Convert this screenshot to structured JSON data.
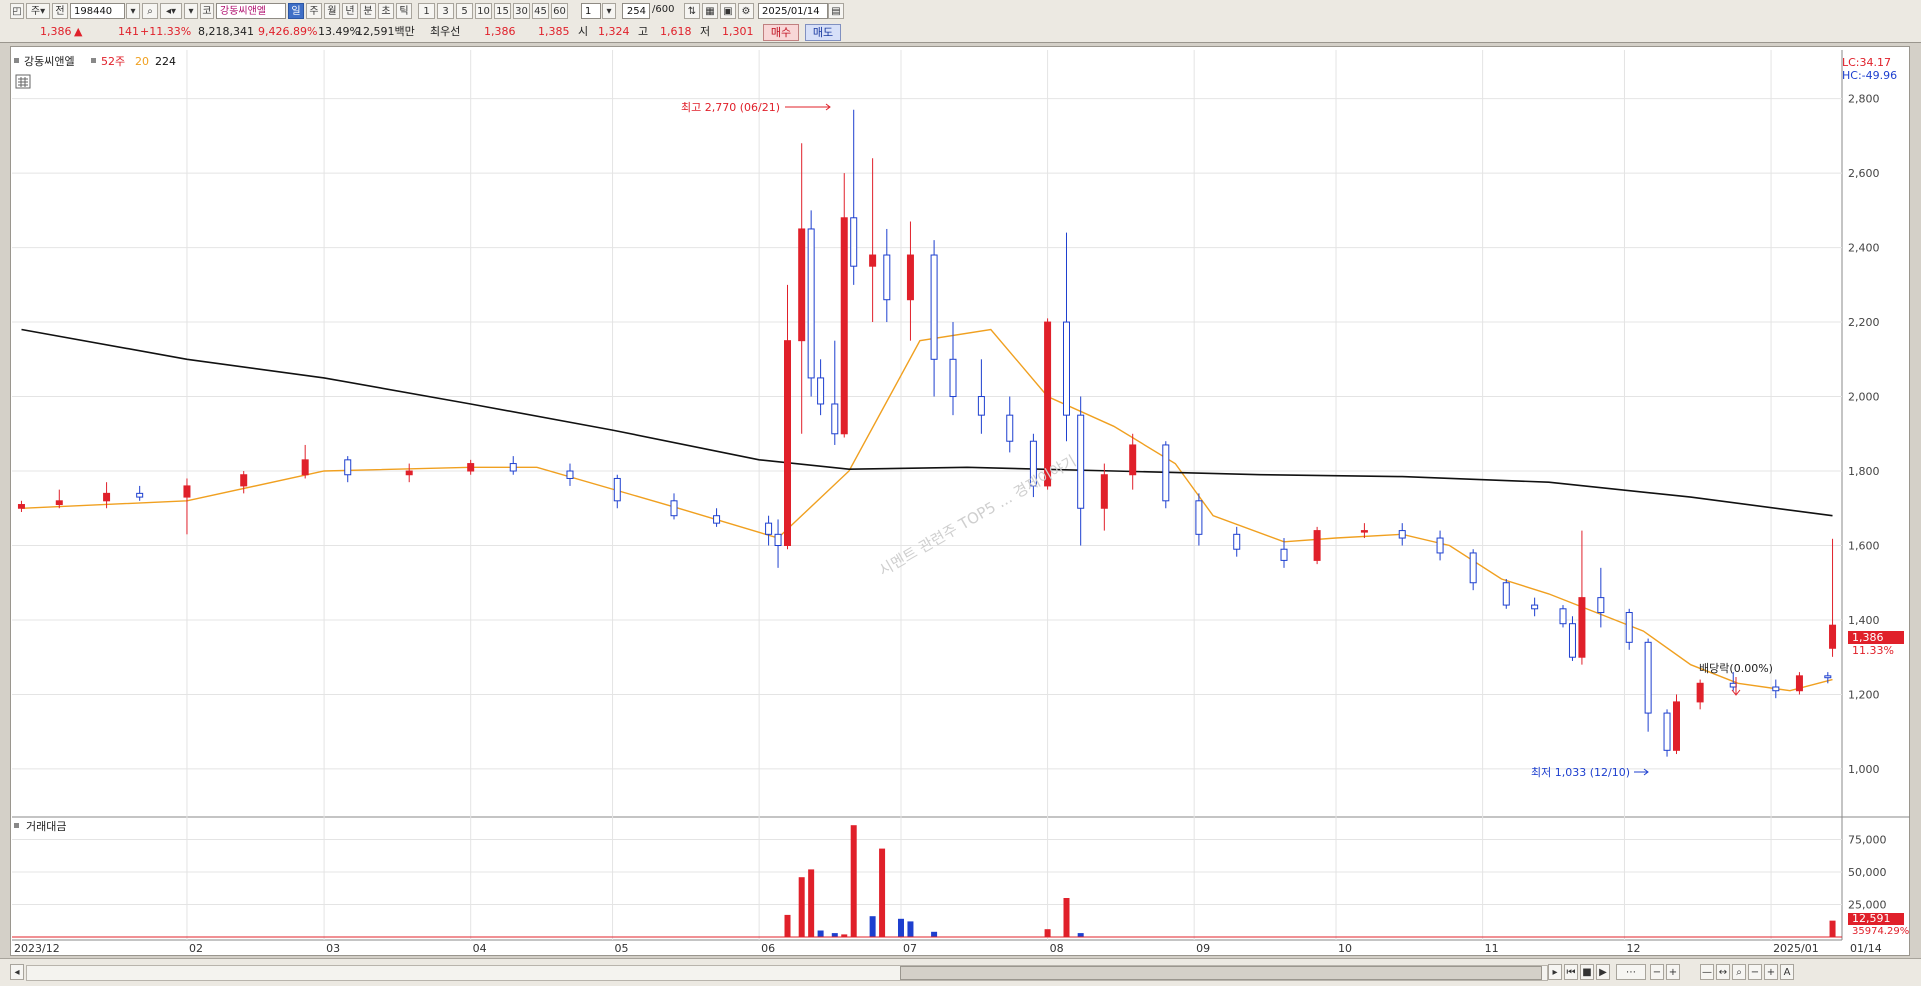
{
  "toolbar": {
    "market": "주",
    "prev_label": "전",
    "code": "198440",
    "name": "강동씨앤엘",
    "periods": [
      "일",
      "주",
      "월",
      "년",
      "분",
      "초",
      "틱"
    ],
    "active_period": "일",
    "minutes": [
      "1",
      "3",
      "5",
      "10",
      "15",
      "30",
      "45",
      "60"
    ],
    "interval_value": "1",
    "count": "254",
    "count_total": "/600",
    "date": "2025/01/14"
  },
  "quote": {
    "price": "1,386",
    "change_arrow": "▲",
    "change": "141",
    "change_pct": "+11.33%",
    "volume": "8,218,341",
    "volume_ratio": "9,426.89%",
    "turnover": "13.49%",
    "amount": "12,591백만",
    "best_bid_label": "최우선",
    "best_ask": "1,386",
    "best_bid": "1,385",
    "open_label": "시",
    "open": "1,324",
    "high_label": "고",
    "high": "1,618",
    "low_label": "저",
    "low": "1,301",
    "buy_label": "매수",
    "sell_label": "매도"
  },
  "legend": {
    "stock": "강동씨앤엘",
    "ma52": "52주",
    "ma20": "20",
    "ma224": "224"
  },
  "price_panel": {
    "lc": "LC:34.17",
    "hc": "HC:-49.96",
    "current_price": "1,386",
    "current_pct": "11.33%",
    "high_note": "최고 2,770 (06/21)",
    "low_note": "최저 1,033 (12/10)",
    "dividend_note": "배당락(0.00%)",
    "watermark": "시멘트 관련주 TOP5 ... 경제이야기"
  },
  "volume_panel": {
    "title": "거래대금",
    "current": "12,591",
    "ratio": "35974.29%"
  },
  "colors": {
    "up": "#e0202a",
    "down": "#1d3fcf",
    "ma20": "#f0a020",
    "ma224": "#111111"
  },
  "chart_data": {
    "type": "candlestick",
    "x_ticks": [
      "2023/12",
      "02",
      "03",
      "04",
      "05",
      "06",
      "07",
      "08",
      "09",
      "10",
      "11",
      "12",
      "2025/01",
      "01/14"
    ],
    "y_ticks": [
      "2,800",
      "2,600",
      "2,400",
      "2,200",
      "2,000",
      "1,800",
      "1,600",
      "1,400",
      "1,200",
      "1,000"
    ],
    "ylim": [
      930,
      2850
    ],
    "volume_ticks": [
      "75,000",
      "50,000",
      "25,000"
    ],
    "volume_ylim": [
      0,
      90000
    ],
    "candles": [
      {
        "d": "2023-12-28",
        "o": 1700,
        "h": 1720,
        "l": 1690,
        "c": 1710
      },
      {
        "d": "2024-01-05",
        "o": 1710,
        "h": 1750,
        "l": 1700,
        "c": 1720
      },
      {
        "d": "2024-01-15",
        "o": 1720,
        "h": 1770,
        "l": 1700,
        "c": 1740
      },
      {
        "d": "2024-01-22",
        "o": 1740,
        "h": 1760,
        "l": 1720,
        "c": 1730
      },
      {
        "d": "2024-02-01",
        "o": 1730,
        "h": 1780,
        "l": 1630,
        "c": 1760
      },
      {
        "d": "2024-02-13",
        "o": 1760,
        "h": 1800,
        "l": 1740,
        "c": 1790
      },
      {
        "d": "2024-02-26",
        "o": 1790,
        "h": 1870,
        "l": 1780,
        "c": 1830
      },
      {
        "d": "2024-03-06",
        "o": 1830,
        "h": 1840,
        "l": 1770,
        "c": 1790
      },
      {
        "d": "2024-03-19",
        "o": 1790,
        "h": 1820,
        "l": 1770,
        "c": 1800
      },
      {
        "d": "2024-04-01",
        "o": 1800,
        "h": 1830,
        "l": 1790,
        "c": 1820
      },
      {
        "d": "2024-04-10",
        "o": 1820,
        "h": 1840,
        "l": 1790,
        "c": 1800
      },
      {
        "d": "2024-04-22",
        "o": 1800,
        "h": 1820,
        "l": 1760,
        "c": 1780
      },
      {
        "d": "2024-05-02",
        "o": 1780,
        "h": 1790,
        "l": 1700,
        "c": 1720
      },
      {
        "d": "2024-05-14",
        "o": 1720,
        "h": 1740,
        "l": 1670,
        "c": 1680
      },
      {
        "d": "2024-05-23",
        "o": 1680,
        "h": 1700,
        "l": 1650,
        "c": 1660
      },
      {
        "d": "2024-06-03",
        "o": 1660,
        "h": 1680,
        "l": 1600,
        "c": 1630
      },
      {
        "d": "2024-06-05",
        "o": 1630,
        "h": 1670,
        "l": 1540,
        "c": 1600
      },
      {
        "d": "2024-06-07",
        "o": 1600,
        "h": 2300,
        "l": 1590,
        "c": 2150
      },
      {
        "d": "2024-06-10",
        "o": 2150,
        "h": 2680,
        "l": 1900,
        "c": 2450
      },
      {
        "d": "2024-06-12",
        "o": 2450,
        "h": 2500,
        "l": 2000,
        "c": 2050
      },
      {
        "d": "2024-06-14",
        "o": 2050,
        "h": 2100,
        "l": 1950,
        "c": 1980
      },
      {
        "d": "2024-06-17",
        "o": 1980,
        "h": 2150,
        "l": 1870,
        "c": 1900
      },
      {
        "d": "2024-06-19",
        "o": 1900,
        "h": 2600,
        "l": 1890,
        "c": 2480
      },
      {
        "d": "2024-06-21",
        "o": 2480,
        "h": 2770,
        "l": 2300,
        "c": 2350
      },
      {
        "d": "2024-06-25",
        "o": 2350,
        "h": 2640,
        "l": 2200,
        "c": 2380
      },
      {
        "d": "2024-06-28",
        "o": 2380,
        "h": 2450,
        "l": 2200,
        "c": 2260
      },
      {
        "d": "2024-07-03",
        "o": 2260,
        "h": 2470,
        "l": 2150,
        "c": 2380
      },
      {
        "d": "2024-07-08",
        "o": 2380,
        "h": 2420,
        "l": 2000,
        "c": 2100
      },
      {
        "d": "2024-07-12",
        "o": 2100,
        "h": 2200,
        "l": 1950,
        "c": 2000
      },
      {
        "d": "2024-07-18",
        "o": 2000,
        "h": 2100,
        "l": 1900,
        "c": 1950
      },
      {
        "d": "2024-07-24",
        "o": 1950,
        "h": 2000,
        "l": 1850,
        "c": 1880
      },
      {
        "d": "2024-07-29",
        "o": 1880,
        "h": 1900,
        "l": 1730,
        "c": 1760
      },
      {
        "d": "2024-08-01",
        "o": 1760,
        "h": 2210,
        "l": 1750,
        "c": 2200
      },
      {
        "d": "2024-08-05",
        "o": 2200,
        "h": 2440,
        "l": 1880,
        "c": 1950
      },
      {
        "d": "2024-08-08",
        "o": 1950,
        "h": 2000,
        "l": 1600,
        "c": 1700
      },
      {
        "d": "2024-08-13",
        "o": 1700,
        "h": 1820,
        "l": 1640,
        "c": 1790
      },
      {
        "d": "2024-08-19",
        "o": 1790,
        "h": 1900,
        "l": 1750,
        "c": 1870
      },
      {
        "d": "2024-08-26",
        "o": 1870,
        "h": 1880,
        "l": 1700,
        "c": 1720
      },
      {
        "d": "2024-09-02",
        "o": 1720,
        "h": 1740,
        "l": 1600,
        "c": 1630
      },
      {
        "d": "2024-09-10",
        "o": 1630,
        "h": 1650,
        "l": 1570,
        "c": 1590
      },
      {
        "d": "2024-09-20",
        "o": 1590,
        "h": 1620,
        "l": 1540,
        "c": 1560
      },
      {
        "d": "2024-09-27",
        "o": 1560,
        "h": 1650,
        "l": 1550,
        "c": 1640
      },
      {
        "d": "2024-10-07",
        "o": 1640,
        "h": 1660,
        "l": 1620,
        "c": 1640
      },
      {
        "d": "2024-10-15",
        "o": 1640,
        "h": 1660,
        "l": 1600,
        "c": 1620
      },
      {
        "d": "2024-10-23",
        "o": 1620,
        "h": 1640,
        "l": 1560,
        "c": 1580
      },
      {
        "d": "2024-10-30",
        "o": 1580,
        "h": 1590,
        "l": 1480,
        "c": 1500
      },
      {
        "d": "2024-11-06",
        "o": 1500,
        "h": 1510,
        "l": 1430,
        "c": 1440
      },
      {
        "d": "2024-11-12",
        "o": 1440,
        "h": 1460,
        "l": 1410,
        "c": 1430
      },
      {
        "d": "2024-11-18",
        "o": 1430,
        "h": 1440,
        "l": 1380,
        "c": 1390
      },
      {
        "d": "2024-11-20",
        "o": 1390,
        "h": 1410,
        "l": 1290,
        "c": 1300
      },
      {
        "d": "2024-11-22",
        "o": 1300,
        "h": 1640,
        "l": 1280,
        "c": 1460
      },
      {
        "d": "2024-11-26",
        "o": 1460,
        "h": 1540,
        "l": 1380,
        "c": 1420
      },
      {
        "d": "2024-12-02",
        "o": 1420,
        "h": 1430,
        "l": 1320,
        "c": 1340
      },
      {
        "d": "2024-12-06",
        "o": 1340,
        "h": 1350,
        "l": 1100,
        "c": 1150
      },
      {
        "d": "2024-12-10",
        "o": 1150,
        "h": 1160,
        "l": 1033,
        "c": 1050
      },
      {
        "d": "2024-12-12",
        "o": 1050,
        "h": 1200,
        "l": 1040,
        "c": 1180
      },
      {
        "d": "2024-12-17",
        "o": 1180,
        "h": 1240,
        "l": 1160,
        "c": 1230
      },
      {
        "d": "2024-12-24",
        "o": 1230,
        "h": 1260,
        "l": 1210,
        "c": 1220
      },
      {
        "d": "2025-01-02",
        "o": 1220,
        "h": 1240,
        "l": 1190,
        "c": 1210
      },
      {
        "d": "2025-01-07",
        "o": 1210,
        "h": 1260,
        "l": 1200,
        "c": 1250
      },
      {
        "d": "2025-01-13",
        "o": 1250,
        "h": 1260,
        "l": 1230,
        "c": 1245
      },
      {
        "d": "2025-01-14",
        "o": 1324,
        "h": 1618,
        "l": 1301,
        "c": 1386
      }
    ],
    "series": [
      {
        "name": "20",
        "points": [
          [
            "2023-12-28",
            1700
          ],
          [
            "2024-02-01",
            1720
          ],
          [
            "2024-03-01",
            1800
          ],
          [
            "2024-04-01",
            1810
          ],
          [
            "2024-04-15",
            1810
          ],
          [
            "2024-05-15",
            1700
          ],
          [
            "2024-06-05",
            1620
          ],
          [
            "2024-06-20",
            1800
          ],
          [
            "2024-07-05",
            2150
          ],
          [
            "2024-07-20",
            2180
          ],
          [
            "2024-08-01",
            2000
          ],
          [
            "2024-08-15",
            1920
          ],
          [
            "2024-08-28",
            1820
          ],
          [
            "2024-09-05",
            1680
          ],
          [
            "2024-09-20",
            1610
          ],
          [
            "2024-10-01",
            1620
          ],
          [
            "2024-10-15",
            1630
          ],
          [
            "2024-10-25",
            1600
          ],
          [
            "2024-11-05",
            1510
          ],
          [
            "2024-11-15",
            1470
          ],
          [
            "2024-11-25",
            1420
          ],
          [
            "2024-12-05",
            1370
          ],
          [
            "2024-12-15",
            1280
          ],
          [
            "2024-12-25",
            1230
          ],
          [
            "2025-01-05",
            1210
          ],
          [
            "2025-01-14",
            1240
          ]
        ]
      },
      {
        "name": "224",
        "points": [
          [
            "2023-12-28",
            2180
          ],
          [
            "2024-02-01",
            2100
          ],
          [
            "2024-03-01",
            2050
          ],
          [
            "2024-04-01",
            1980
          ],
          [
            "2024-05-01",
            1910
          ],
          [
            "2024-06-01",
            1830
          ],
          [
            "2024-06-20",
            1805
          ],
          [
            "2024-07-15",
            1810
          ],
          [
            "2024-08-15",
            1800
          ],
          [
            "2024-09-15",
            1790
          ],
          [
            "2024-10-15",
            1785
          ],
          [
            "2024-11-15",
            1770
          ],
          [
            "2024-12-15",
            1730
          ],
          [
            "2025-01-14",
            1680
          ]
        ]
      }
    ],
    "volume": [
      {
        "d": "2024-06-07",
        "v": 17000,
        "up": true
      },
      {
        "d": "2024-06-10",
        "v": 46000,
        "up": true
      },
      {
        "d": "2024-06-12",
        "v": 52000,
        "up": true
      },
      {
        "d": "2024-06-14",
        "v": 5000,
        "up": false
      },
      {
        "d": "2024-06-17",
        "v": 3000,
        "up": false
      },
      {
        "d": "2024-06-19",
        "v": 2000,
        "up": true
      },
      {
        "d": "2024-06-21",
        "v": 86000,
        "up": true
      },
      {
        "d": "2024-06-25",
        "v": 16000,
        "up": false
      },
      {
        "d": "2024-06-27",
        "v": 68000,
        "up": true
      },
      {
        "d": "2024-07-01",
        "v": 14000,
        "up": false
      },
      {
        "d": "2024-07-03",
        "v": 12000,
        "up": false
      },
      {
        "d": "2024-07-08",
        "v": 4000,
        "up": false
      },
      {
        "d": "2024-08-01",
        "v": 6000,
        "up": true
      },
      {
        "d": "2024-08-05",
        "v": 30000,
        "up": true
      },
      {
        "d": "2024-08-08",
        "v": 3000,
        "up": false
      },
      {
        "d": "2025-01-14",
        "v": 12591,
        "up": true
      }
    ]
  }
}
